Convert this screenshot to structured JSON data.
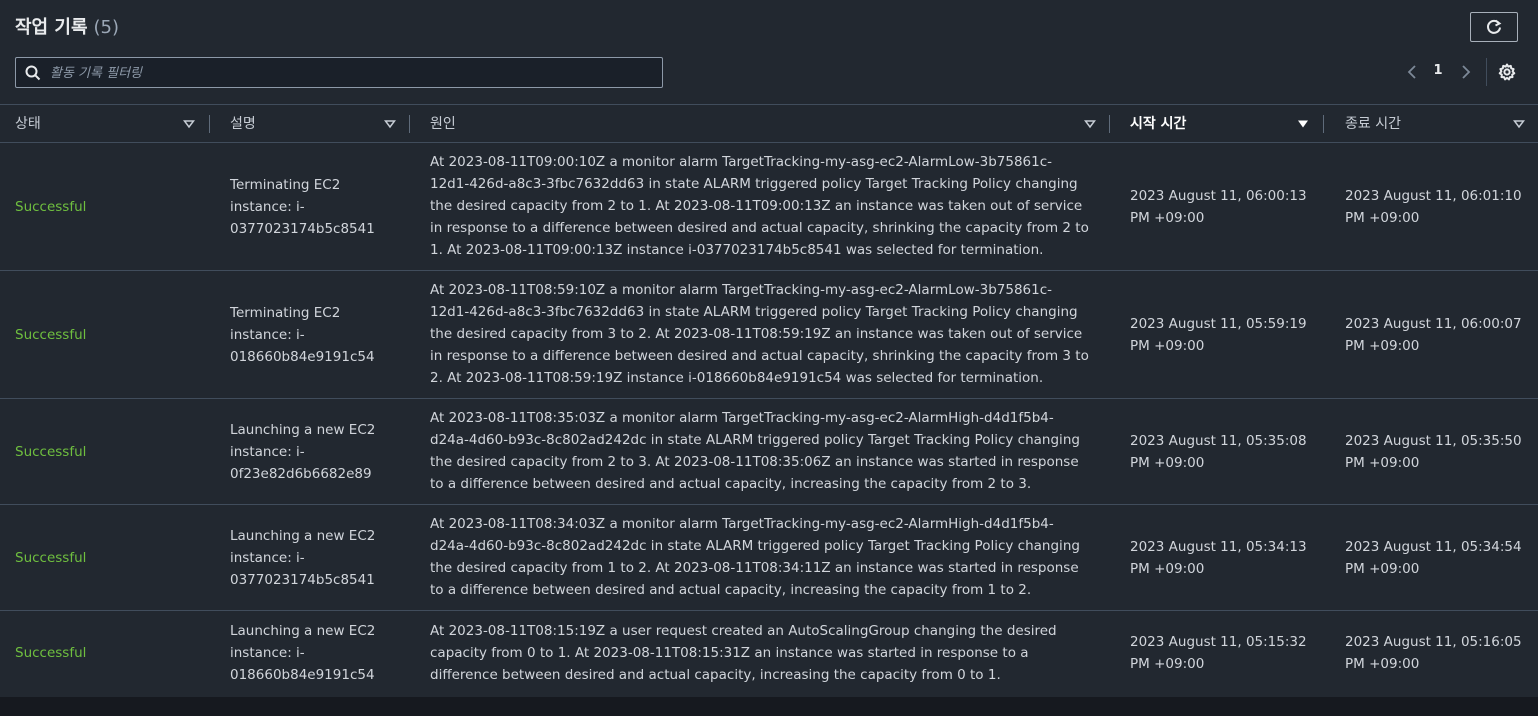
{
  "header": {
    "title": "작업 기록",
    "count": "(5)"
  },
  "search": {
    "placeholder": "활동 기록 필터링"
  },
  "pagination": {
    "current_page": "1"
  },
  "columns": [
    {
      "label": "상태"
    },
    {
      "label": "설명"
    },
    {
      "label": "원인"
    },
    {
      "label": "시작 시간"
    },
    {
      "label": "종료 시간"
    }
  ],
  "rows": [
    {
      "status": "Successful",
      "description": "Terminating EC2 instance: i-0377023174b5c8541",
      "cause": "At 2023-08-11T09:00:10Z a monitor alarm TargetTracking-my-asg-ec2-AlarmLow-3b75861c-12d1-426d-a8c3-3fbc7632dd63 in state ALARM triggered policy Target Tracking Policy changing the desired capacity from 2 to 1. At 2023-08-11T09:00:13Z an instance was taken out of service in response to a difference between desired and actual capacity, shrinking the capacity from 2 to 1. At 2023-08-11T09:00:13Z instance i-0377023174b5c8541 was selected for termination.",
      "start_time": "2023 August 11, 06:00:13 PM +09:00",
      "end_time": "2023 August 11, 06:01:10 PM +09:00"
    },
    {
      "status": "Successful",
      "description": "Terminating EC2 instance: i-018660b84e9191c54",
      "cause": "At 2023-08-11T08:59:10Z a monitor alarm TargetTracking-my-asg-ec2-AlarmLow-3b75861c-12d1-426d-a8c3-3fbc7632dd63 in state ALARM triggered policy Target Tracking Policy changing the desired capacity from 3 to 2. At 2023-08-11T08:59:19Z an instance was taken out of service in response to a difference between desired and actual capacity, shrinking the capacity from 3 to 2. At 2023-08-11T08:59:19Z instance i-018660b84e9191c54 was selected for termination.",
      "start_time": "2023 August 11, 05:59:19 PM +09:00",
      "end_time": "2023 August 11, 06:00:07 PM +09:00"
    },
    {
      "status": "Successful",
      "description": "Launching a new EC2 instance: i-0f23e82d6b6682e89",
      "cause": "At 2023-08-11T08:35:03Z a monitor alarm TargetTracking-my-asg-ec2-AlarmHigh-d4d1f5b4-d24a-4d60-b93c-8c802ad242dc in state ALARM triggered policy Target Tracking Policy changing the desired capacity from 2 to 3. At 2023-08-11T08:35:06Z an instance was started in response to a difference between desired and actual capacity, increasing the capacity from 2 to 3.",
      "start_time": "2023 August 11, 05:35:08 PM +09:00",
      "end_time": "2023 August 11, 05:35:50 PM +09:00"
    },
    {
      "status": "Successful",
      "description": "Launching a new EC2 instance: i-0377023174b5c8541",
      "cause": "At 2023-08-11T08:34:03Z a monitor alarm TargetTracking-my-asg-ec2-AlarmHigh-d4d1f5b4-d24a-4d60-b93c-8c802ad242dc in state ALARM triggered policy Target Tracking Policy changing the desired capacity from 1 to 2. At 2023-08-11T08:34:11Z an instance was started in response to a difference between desired and actual capacity, increasing the capacity from 1 to 2.",
      "start_time": "2023 August 11, 05:34:13 PM +09:00",
      "end_time": "2023 August 11, 05:34:54 PM +09:00"
    },
    {
      "status": "Successful",
      "description": "Launching a new EC2 instance: i-018660b84e9191c54",
      "cause": "At 2023-08-11T08:15:19Z a user request created an AutoScalingGroup changing the desired capacity from 0 to 1. At 2023-08-11T08:15:31Z an instance was started in response to a difference between desired and actual capacity, increasing the capacity from 0 to 1.",
      "start_time": "2023 August 11, 05:15:32 PM +09:00",
      "end_time": "2023 August 11, 05:16:05 PM +09:00"
    }
  ]
}
